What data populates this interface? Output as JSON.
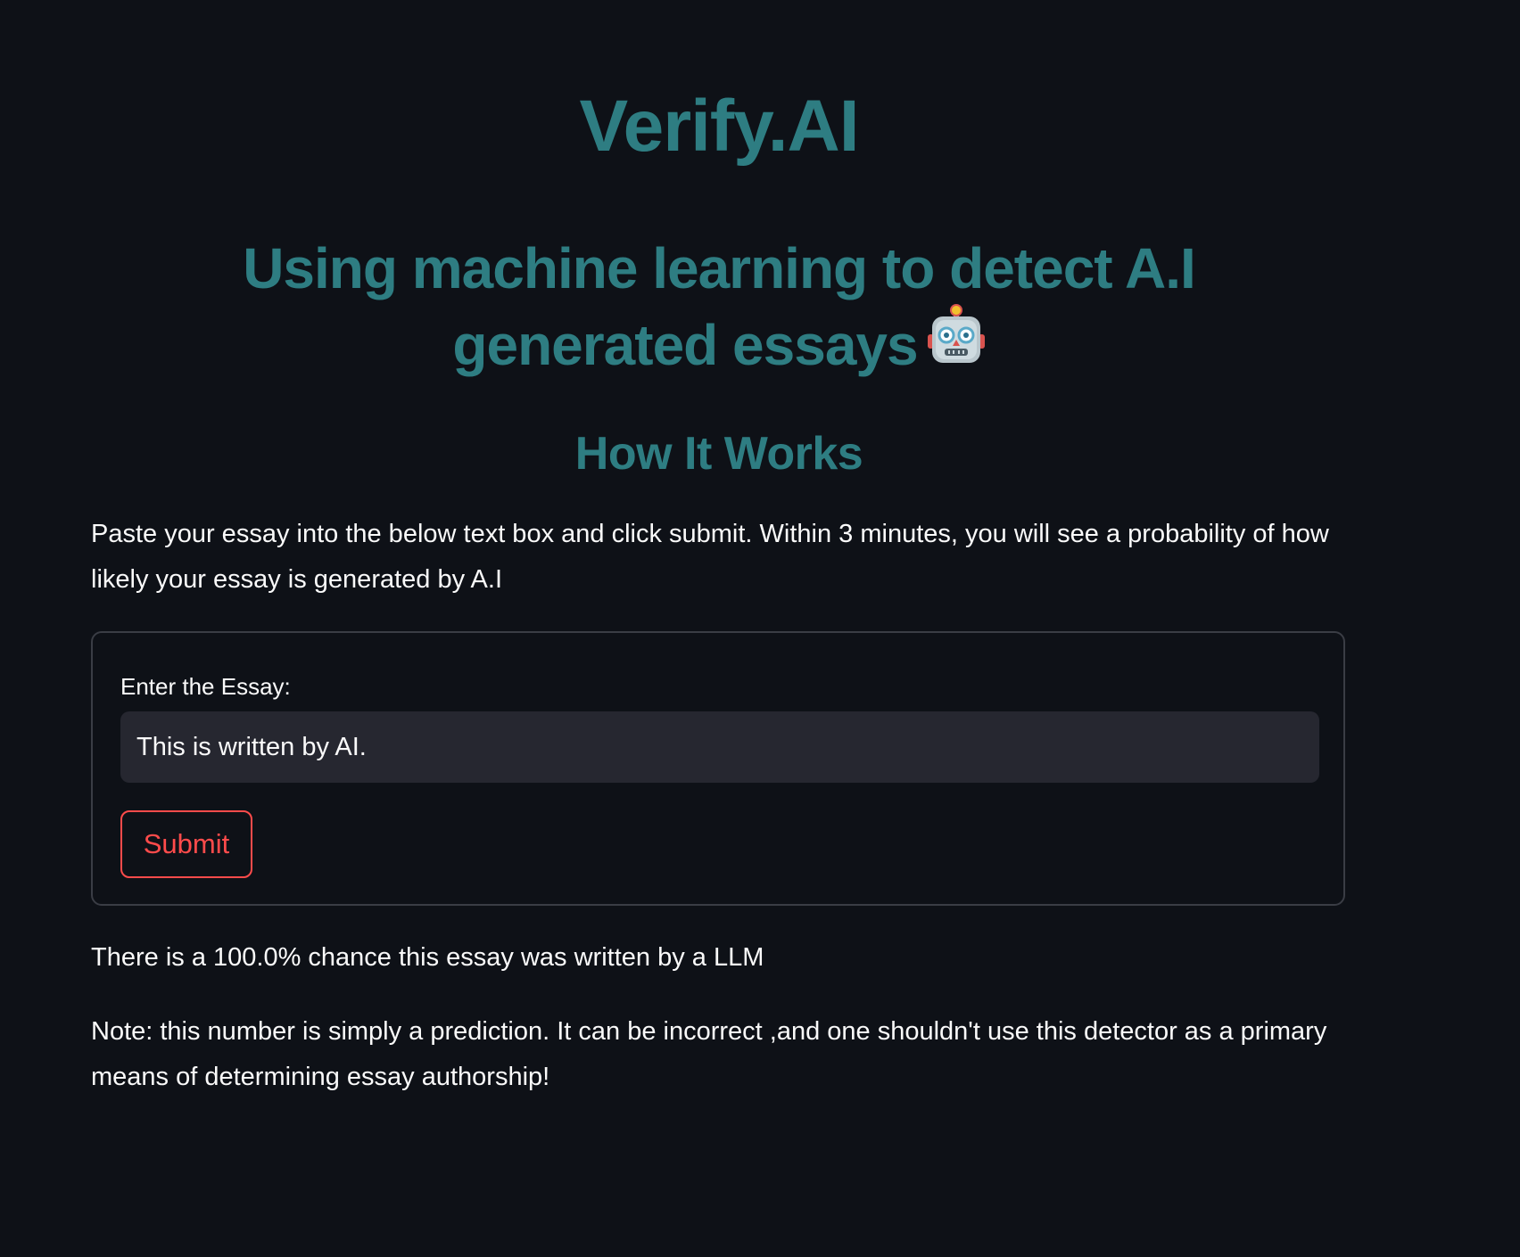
{
  "header": {
    "title": "Verify.AI",
    "tagline": "Using machine learning to detect A.I generated essays",
    "tagline_icon": "robot-face-icon"
  },
  "how_it_works": {
    "title": "How It Works",
    "instructions": "Paste your essay into the below text box and click submit. Within 3 minutes, you will see a probability of how likely your essay is generated by A.I"
  },
  "form": {
    "label": "Enter the Essay:",
    "essay_value": "This is written by AI.",
    "submit_label": "Submit"
  },
  "result": {
    "message": "There is a 100.0% chance this essay was written by a LLM",
    "note": "Note: this number is simply a prediction. It can be incorrect ,and one shouldn't use this detector as a primary means of determining essay authorship!"
  },
  "colors": {
    "background": "#0e1117",
    "heading": "#2e7d82",
    "text": "#fafafa",
    "input_background": "#262730",
    "accent": "#ff4b4b",
    "border": "#3a3d45"
  }
}
